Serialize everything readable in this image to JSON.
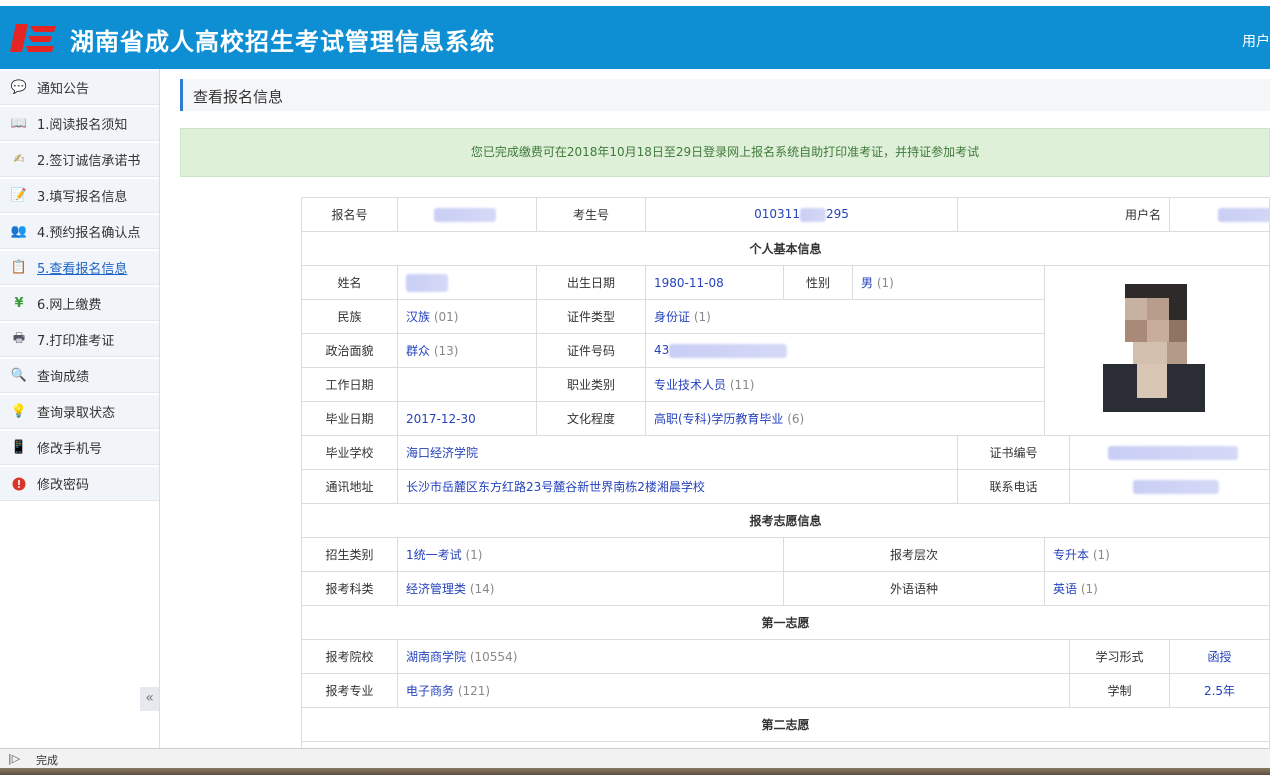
{
  "header": {
    "title": "湖南省成人高校招生考试管理信息系统",
    "user_label": "用户"
  },
  "sidebar": {
    "items": [
      {
        "label": "通知公告",
        "icon": "speech-bubble-icon"
      },
      {
        "label": "1.阅读报名须知",
        "icon": "book-icon"
      },
      {
        "label": "2.签订诚信承诺书",
        "icon": "signing-icon"
      },
      {
        "label": "3.填写报名信息",
        "icon": "edit-form-icon"
      },
      {
        "label": "4.预约报名确认点",
        "icon": "people-icon"
      },
      {
        "label": "5.查看报名信息",
        "icon": "clipboard-icon",
        "active": true
      },
      {
        "label": "6.网上缴费",
        "icon": "yen-icon"
      },
      {
        "label": "7.打印准考证",
        "icon": "printer-icon"
      },
      {
        "label": "查询成绩",
        "icon": "magnifier-icon"
      },
      {
        "label": "查询录取状态",
        "icon": "lightbulb-icon"
      },
      {
        "label": "修改手机号",
        "icon": "phone-icon"
      },
      {
        "label": "修改密码",
        "icon": "alert-icon"
      }
    ],
    "collapse_symbol": "«"
  },
  "page": {
    "title": "查看报名信息",
    "notice": "您已完成缴费可在2018年10月18日至29日登录网上报名系统自助打印准考证，并持证参加考试"
  },
  "record": {
    "labels": {
      "reg_no": "报名号",
      "exam_no": "考生号",
      "username": "用户名",
      "sec_basic": "个人基本信息",
      "name": "姓名",
      "birth": "出生日期",
      "gender": "性别",
      "ethnicity": "民族",
      "id_type": "证件类型",
      "politics": "政治面貌",
      "id_no": "证件号码",
      "work_date": "工作日期",
      "job_type": "职业类别",
      "grad_date": "毕业日期",
      "education": "文化程度",
      "grad_school": "毕业学校",
      "cert_no": "证书编号",
      "address": "通讯地址",
      "phone": "联系电话",
      "sec_apply": "报考志愿信息",
      "enroll_type": "招生类别",
      "level": "报考层次",
      "subject": "报考科类",
      "language": "外语语种",
      "sec_first": "第一志愿",
      "college": "报考院校",
      "study_form": "学习形式",
      "major": "报考专业",
      "duration": "学制",
      "sec_second": "第二志愿"
    },
    "values": {
      "exam_no": "010311",
      "exam_no_tail": "295",
      "birth": "1980-11-08",
      "gender": "男",
      "gender_code": "(1)",
      "ethnicity": "汉族",
      "ethnicity_code": "(01)",
      "id_type": "身份证",
      "id_type_code": "(1)",
      "politics": "群众",
      "politics_code": "(13)",
      "id_no_prefix": "43",
      "job_type": "专业技术人员",
      "job_type_code": "(11)",
      "grad_date": "2017-12-30",
      "education": "高职(专科)学历教育毕业",
      "education_code": "(6)",
      "grad_school": "海口经济学院",
      "address": "长沙市岳麓区东方红路23号麓谷新世界南栋2楼湘晨学校",
      "enroll_type": "1统一考试",
      "enroll_type_code": "(1)",
      "level": "专升本",
      "level_code": "(1)",
      "subject": "经济管理类",
      "subject_code": "(14)",
      "language": "英语",
      "language_code": "(1)",
      "college": "湖南商学院",
      "college_code": "(10554)",
      "study_form": "函授",
      "major": "电子商务",
      "major_code": "(121)",
      "duration": "2.5年"
    }
  },
  "statusbar": {
    "text": "完成"
  }
}
